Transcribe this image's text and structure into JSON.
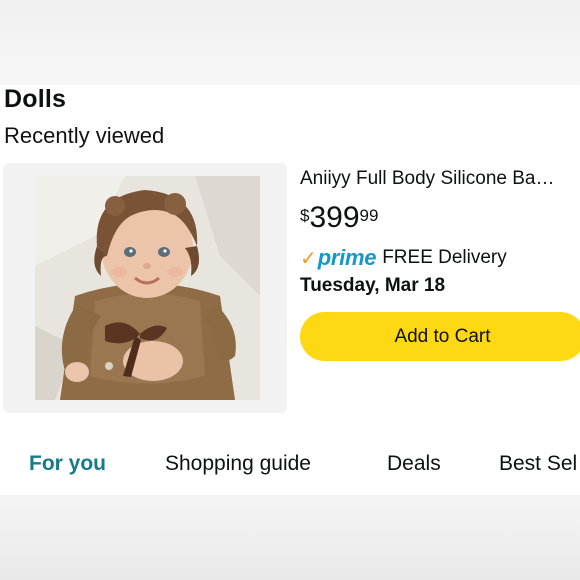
{
  "section": {
    "title": "Dolls",
    "subtitle": "Recently viewed"
  },
  "product": {
    "title": "Aniiyy Full Body Silicone Ba…",
    "price": {
      "symbol": "$",
      "whole": "399",
      "fraction": "99"
    },
    "prime": {
      "check": "✓",
      "word": "prime",
      "delivery": "FREE Delivery"
    },
    "delivery_date": "Tuesday, Mar 18",
    "image_icon": "baby-doll-photo"
  },
  "cart_button": {
    "label": "Add to Cart"
  },
  "tabs": [
    {
      "label": "For you",
      "active": true
    },
    {
      "label": "Shopping guide",
      "active": false
    },
    {
      "label": "Deals",
      "active": false
    },
    {
      "label": "Best Sel",
      "active": false
    }
  ],
  "colors": {
    "prime_blue": "#1399c9",
    "prime_check": "#f29c1f",
    "cart_yellow": "#ffd814",
    "active_tab": "#157a8a"
  }
}
